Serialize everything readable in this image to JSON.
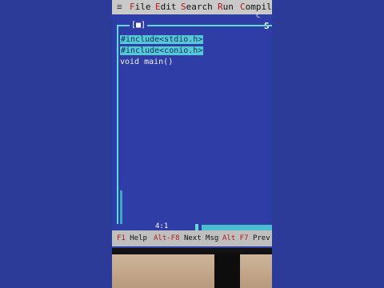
{
  "menu": {
    "system": "≡",
    "items": [
      {
        "label": "File",
        "hot": "F",
        "rest": "ile"
      },
      {
        "label": "Edit",
        "hot": "E",
        "rest": "dit"
      },
      {
        "label": "Search",
        "hot": "S",
        "rest": "earch"
      },
      {
        "label": "Run",
        "hot": "R",
        "rest": "un"
      },
      {
        "label": "Compile",
        "hot": "C",
        "rest": "ompile"
      }
    ]
  },
  "window": {
    "close_label": "[■]",
    "title_fragment": "S",
    "badge": "C"
  },
  "code": [
    {
      "text": "#include<stdio.h>",
      "selected": true
    },
    {
      "text": "#include<conio.h>",
      "selected": true
    },
    {
      "text": "void main()",
      "selected": false
    }
  ],
  "status": {
    "cursor_pos": "4:1"
  },
  "hints": [
    {
      "key": "F1",
      "label": "Help"
    },
    {
      "key": "Alt-F8",
      "label": "Next Msg"
    },
    {
      "key": "Alt F7",
      "label": "Prev"
    }
  ]
}
